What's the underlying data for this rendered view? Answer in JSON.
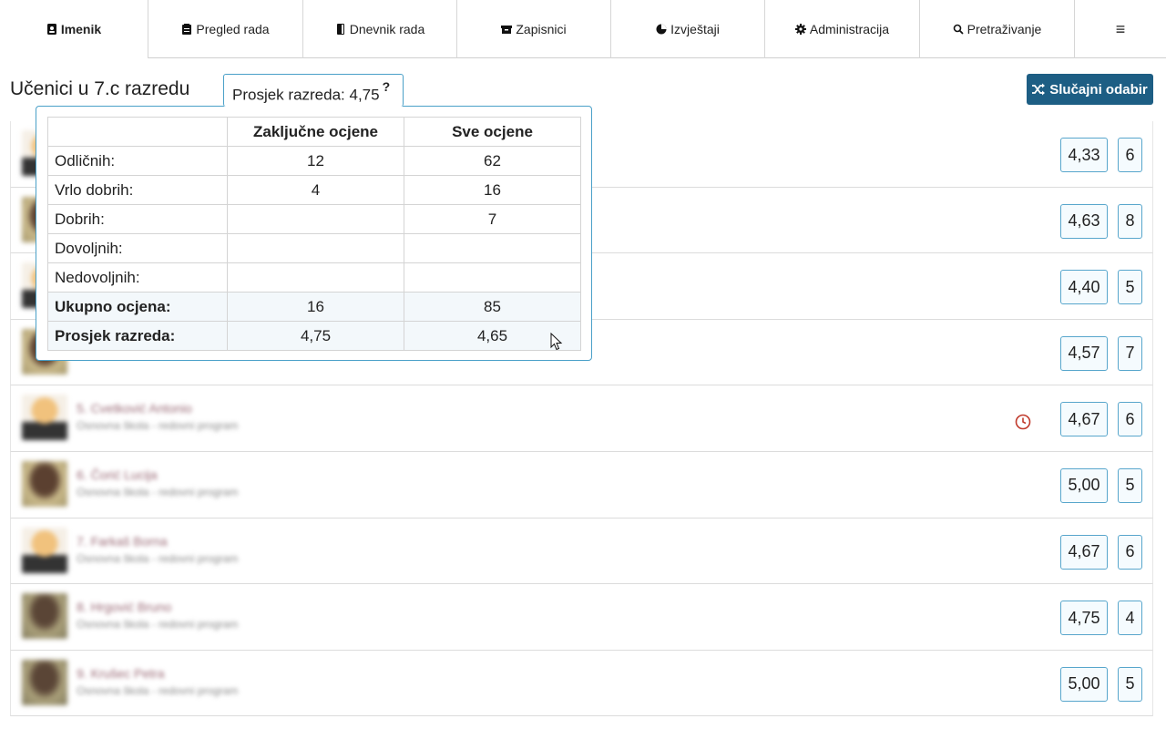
{
  "nav": {
    "items": [
      {
        "label": "Imenik",
        "icon": "address-book-icon",
        "active": true
      },
      {
        "label": "Pregled rada",
        "icon": "clipboard-icon"
      },
      {
        "label": "Dnevnik rada",
        "icon": "book-icon"
      },
      {
        "label": "Zapisnici",
        "icon": "archive-icon"
      },
      {
        "label": "Izvještaji",
        "icon": "pie-chart-icon"
      },
      {
        "label": "Administracija",
        "icon": "gear-icon"
      },
      {
        "label": "Pretraživanje",
        "icon": "search-icon"
      }
    ],
    "menu_icon": "hamburger-icon",
    "menu_glyph": "≡"
  },
  "header": {
    "title": "Učenici u 7.c razredu",
    "avg_label": "Prosjek razreda: 4,75",
    "avg_help": "?",
    "random_button": "Slučajni odabir",
    "random_icon": "shuffle-icon"
  },
  "popover": {
    "columns": [
      "",
      "Zaključne ocjene",
      "Sve ocjene"
    ],
    "rows": [
      {
        "label": "Odličnih:",
        "final": "12",
        "all": "62"
      },
      {
        "label": "Vrlo dobrih:",
        "final": "4",
        "all": "16"
      },
      {
        "label": "Dobrih:",
        "final": "",
        "all": "7"
      },
      {
        "label": "Dovoljnih:",
        "final": "",
        "all": ""
      },
      {
        "label": "Nedovoljnih:",
        "final": "",
        "all": ""
      }
    ],
    "totals": [
      {
        "label": "Ukupno ocjena:",
        "final": "16",
        "all": "85"
      },
      {
        "label": "Prosjek razreda:",
        "final": "4,75",
        "all": "4,65"
      }
    ]
  },
  "students": [
    {
      "name": "",
      "program": "",
      "avg": "4,33",
      "count": "6",
      "avatar": "yellow"
    },
    {
      "name": "",
      "program": "",
      "avg": "4,63",
      "count": "8",
      "avatar": "photo"
    },
    {
      "name": "",
      "program": "",
      "avg": "4,40",
      "count": "5",
      "avatar": "yellow"
    },
    {
      "name": "",
      "program": "",
      "avg": "4,57",
      "count": "7",
      "avatar": "photo"
    },
    {
      "name": "5. Cvetković Antonio",
      "program": "Osnovna škola - redovni program",
      "avg": "4,67",
      "count": "6",
      "avatar": "yellow",
      "clock": true
    },
    {
      "name": "6. Čorić Lucija",
      "program": "Osnovna škola - redovni program",
      "avg": "5,00",
      "count": "5",
      "avatar": "photo"
    },
    {
      "name": "7. Farkaš Borna",
      "program": "Osnovna škola - redovni program",
      "avg": "4,67",
      "count": "6",
      "avatar": "yellow"
    },
    {
      "name": "8. Hrgović Bruno",
      "program": "Osnovna škola - redovni program",
      "avg": "4,75",
      "count": "4",
      "avatar": "dark"
    },
    {
      "name": "9. Krušec Petra",
      "program": "Osnovna škola - redovni program",
      "avg": "5,00",
      "count": "5",
      "avatar": "dark"
    }
  ]
}
